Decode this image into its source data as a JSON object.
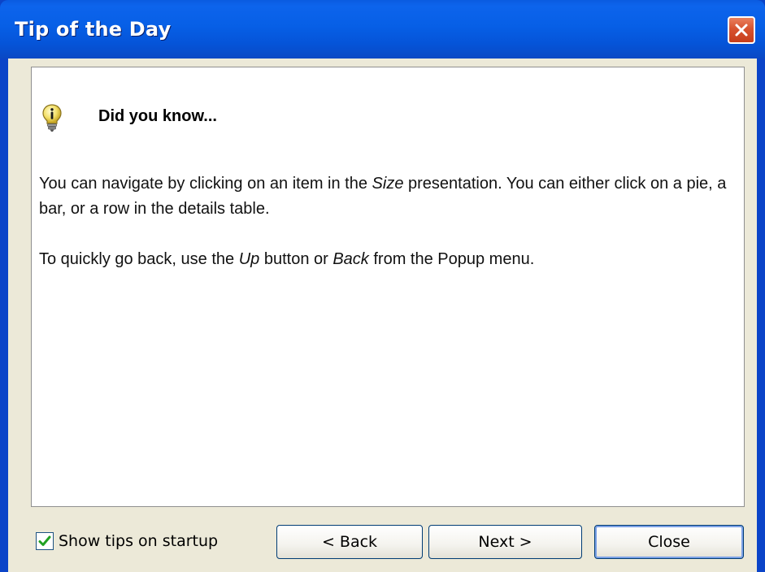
{
  "window": {
    "title": "Tip of the Day",
    "close_icon": "close-x-icon"
  },
  "content": {
    "icon": "lightbulb-info-icon",
    "heading": "Did you know...",
    "paragraph1": {
      "part1": "You can navigate by clicking on an item in the ",
      "emphasis": "Size",
      "part2": " presentation. You can either click on a pie, a bar, or a row in the details table."
    },
    "paragraph2": {
      "part1": "To quickly go back, use the ",
      "emphasis1": "Up",
      "part2": " button or ",
      "emphasis2": "Back",
      "part3": " from the Popup menu."
    }
  },
  "footer": {
    "checkbox_label": "Show tips on startup",
    "checkbox_checked": true,
    "back_label": "< Back",
    "next_label": "Next >",
    "close_label": "Close"
  },
  "colors": {
    "titlebar": "#0554d8",
    "dialog_bg": "#ece9d8",
    "close_button": "#d7532f",
    "check_mark": "#21a121"
  }
}
